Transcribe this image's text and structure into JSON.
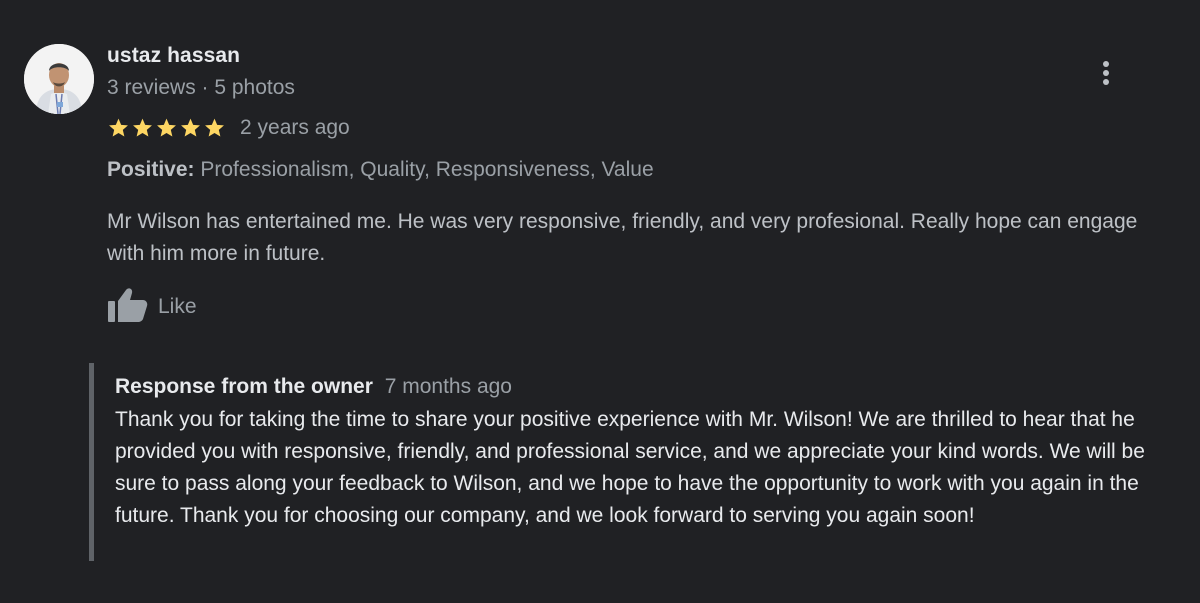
{
  "review": {
    "reviewer_name": "ustaz hassan",
    "reviewer_meta": "3 reviews · 5 photos",
    "rating": 5,
    "rating_max": 5,
    "age": "2 years ago",
    "attributes_label": "Positive:",
    "attributes_values": "Professionalism, Quality, Responsiveness, Value",
    "text": "Mr Wilson has entertained me. He was very responsive, friendly, and very profesional. Really hope can engage with him more in future.",
    "like_label": "Like"
  },
  "owner_response": {
    "title": "Response from the owner",
    "age": "7 months ago",
    "text": "Thank you for taking the time to share your positive experience with Mr. Wilson! We are thrilled to hear that he provided you with responsive, friendly, and professional service, and we appreciate your kind words. We will be sure to pass along your feedback to Wilson, and we hope to have the opportunity to work with you again in the future. Thank you for choosing our company, and we look forward to serving you again soon!"
  },
  "colors": {
    "background": "#202124",
    "primary_text": "#e8eaed",
    "secondary_text": "#9aa0a6",
    "body_text": "#bdc1c6",
    "star": "#fdd663",
    "response_border": "#5f6368"
  },
  "icons": {
    "more": "more-vert-icon",
    "like": "thumb-up-icon",
    "star": "star-icon"
  }
}
